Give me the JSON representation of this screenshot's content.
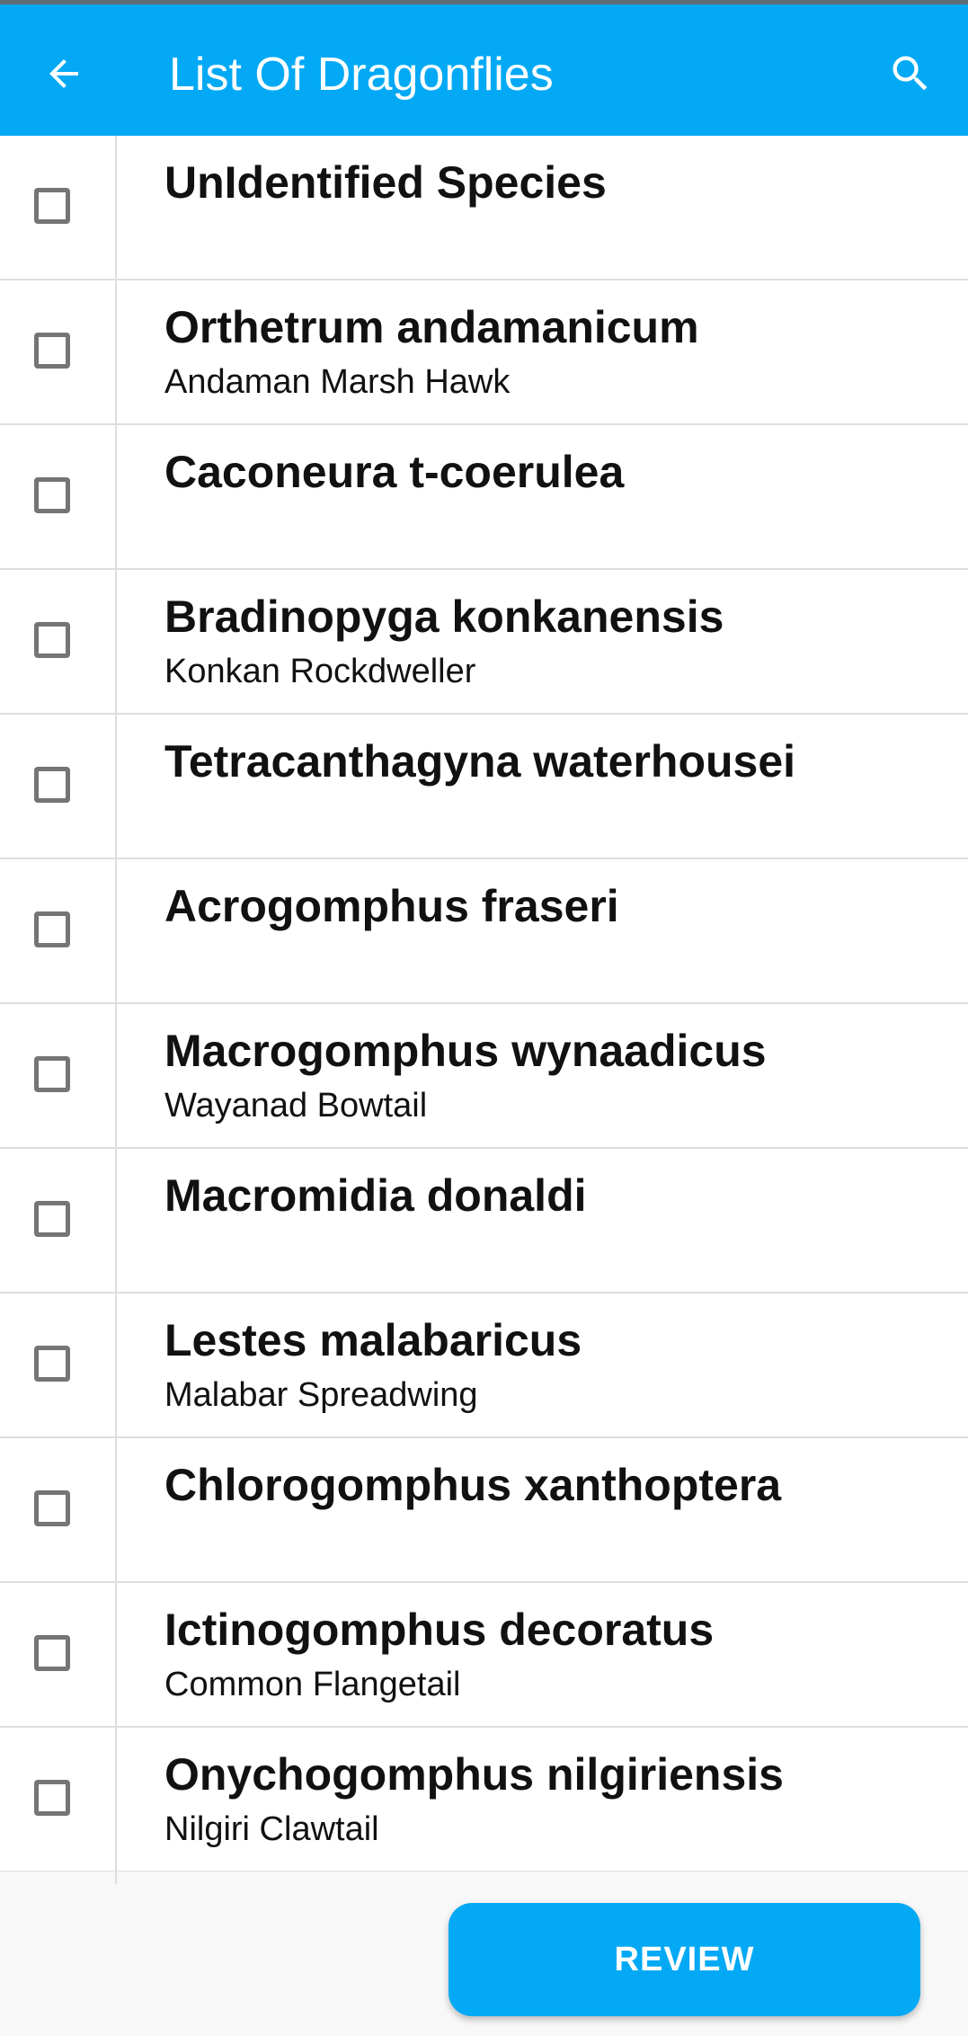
{
  "colors": {
    "primary": "#03A9F4",
    "text": "#111111",
    "checkbox_border": "#757575",
    "divider": "#dedede"
  },
  "appbar": {
    "title": "List Of Dragonflies",
    "back_icon": "arrow-back-icon",
    "search_icon": "search-icon"
  },
  "species": [
    {
      "scientific": "UnIdentified Species",
      "common": ""
    },
    {
      "scientific": "Orthetrum andamanicum",
      "common": "Andaman Marsh Hawk"
    },
    {
      "scientific": "Caconeura t-coerulea",
      "common": ""
    },
    {
      "scientific": "Bradinopyga konkanensis",
      "common": "Konkan Rockdweller"
    },
    {
      "scientific": "Tetracanthagyna waterhousei",
      "common": ""
    },
    {
      "scientific": "Acrogomphus fraseri",
      "common": ""
    },
    {
      "scientific": "Macrogomphus wynaadicus",
      "common": "Wayanad Bowtail"
    },
    {
      "scientific": "Macromidia donaldi",
      "common": ""
    },
    {
      "scientific": "Lestes malabaricus",
      "common": "Malabar Spreadwing"
    },
    {
      "scientific": "Chlorogomphus xanthoptera",
      "common": ""
    },
    {
      "scientific": "Ictinogomphus decoratus",
      "common": "Common Flangetail"
    },
    {
      "scientific": "Onychogomphus nilgiriensis",
      "common": "Nilgiri Clawtail"
    }
  ],
  "footer": {
    "review_label": "REVIEW"
  }
}
